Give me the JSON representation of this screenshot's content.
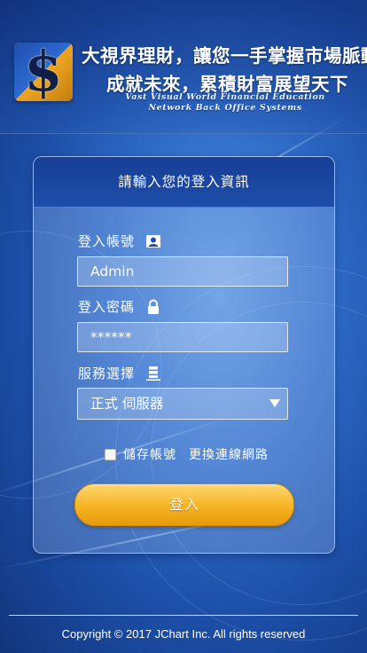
{
  "header": {
    "slogan_line1": "大視界理財，讓您一手掌握市場脈動",
    "slogan_line2": "成就未來，累積財富展望天下",
    "english_line1": "Vast Visual World Financial Education",
    "english_line2": "Network Back Office Systems",
    "logo_glyph": "$",
    "logo_icon": "dollar-sign-logo"
  },
  "login": {
    "title": "請輸入您的登入資訊",
    "account_label": "登入帳號",
    "account_icon": "user-card-icon",
    "account_value": "Admin",
    "password_label": "登入密碼",
    "password_icon": "lock-icon",
    "password_value": "******",
    "server_label": "服務選擇",
    "server_icon": "server-icon",
    "server_selected": "正式 伺服器",
    "remember_label": "儲存帳號",
    "remember_checked": false,
    "switch_network_label": "更換連線網路",
    "login_button": "登入"
  },
  "footer": {
    "copyright": "Copyright © 2017 JChart Inc. All rights reserved"
  },
  "colors": {
    "background": "#2f6cc8",
    "panel_header": "#1d4ea9",
    "button": "#f6b322"
  }
}
